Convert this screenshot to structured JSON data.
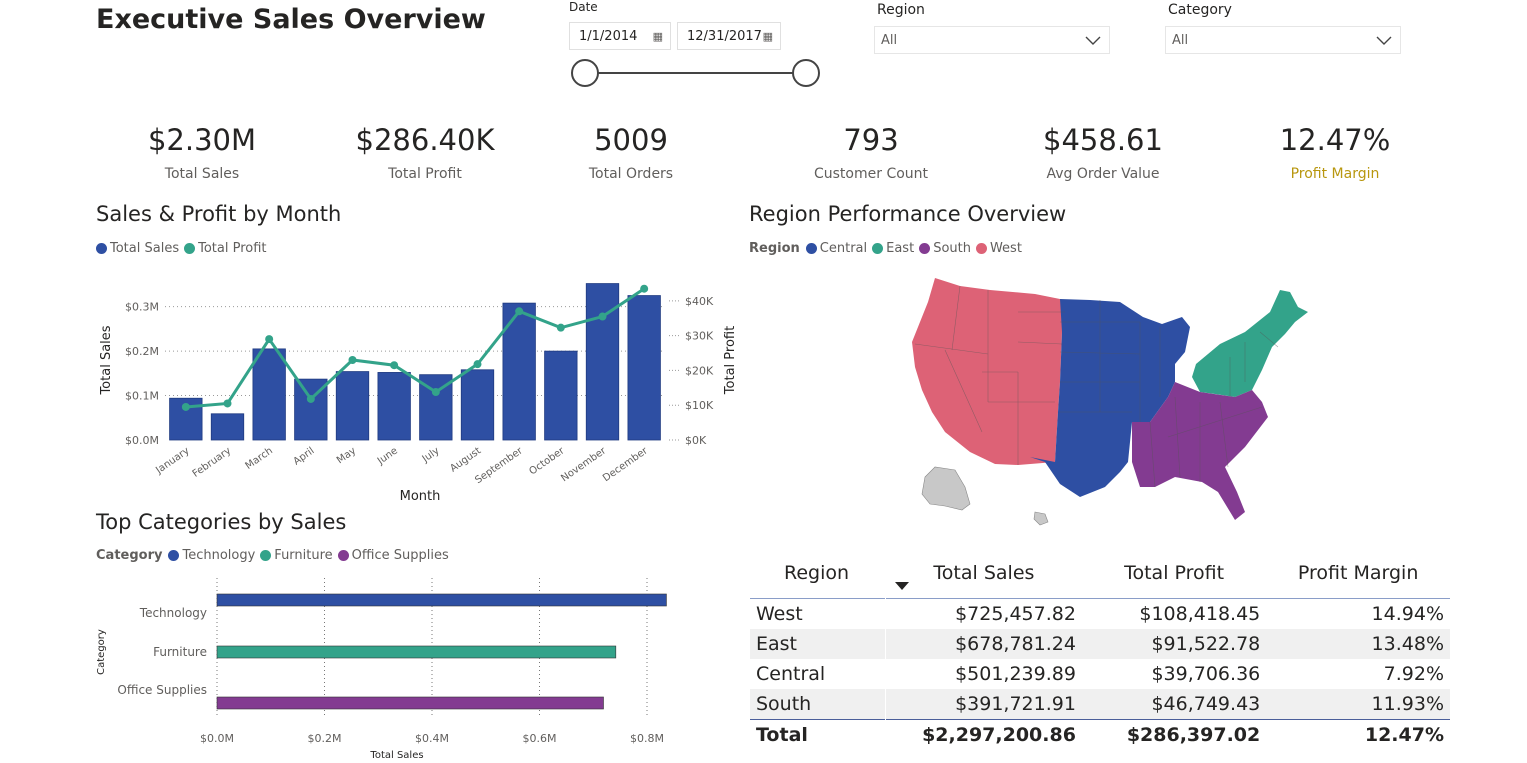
{
  "title": "Executive Sales Overview",
  "filters": {
    "date_label": "Date",
    "date_start": "1/1/2014",
    "date_end": "12/31/2017",
    "region_label": "Region",
    "region_value": "All",
    "category_label": "Category",
    "category_value": "All"
  },
  "kpis": [
    {
      "value": "$2.30M",
      "label": "Total Sales"
    },
    {
      "value": "$286.40K",
      "label": "Total Profit"
    },
    {
      "value": "5009",
      "label": "Total Orders"
    },
    {
      "value": "793",
      "label": "Customer Count"
    },
    {
      "value": "$458.61",
      "label": "Avg Order Value"
    },
    {
      "value": "12.47%",
      "label": "Profit Margin"
    }
  ],
  "colors": {
    "blue": "#2e4fa3",
    "teal": "#33a38a",
    "purple": "#833b91",
    "pink": "#dd6276",
    "gray": "#c8c8c8",
    "profit_margin_label": "#b8970f"
  },
  "map_section": {
    "title": "Region Performance Overview",
    "legend_title": "Region",
    "legend": [
      "Central",
      "East",
      "South",
      "West"
    ]
  },
  "chart_data": [
    {
      "type": "bar",
      "title": "Sales & Profit by Month",
      "xlabel": "Month",
      "ylabel": "Total Sales",
      "y2label": "Total Profit",
      "categories": [
        "January",
        "February",
        "March",
        "April",
        "May",
        "June",
        "July",
        "August",
        "September",
        "October",
        "November",
        "December"
      ],
      "series": [
        {
          "name": "Total Sales",
          "type": "bar",
          "axis": "left",
          "values": [
            94000,
            59000,
            205000,
            137000,
            154000,
            152000,
            147000,
            158000,
            308000,
            200000,
            352000,
            325000
          ]
        },
        {
          "name": "Total Profit",
          "type": "line",
          "axis": "right",
          "values": [
            9500,
            10500,
            29000,
            11800,
            23000,
            21500,
            13800,
            21800,
            37000,
            32300,
            35500,
            43500
          ]
        }
      ],
      "yticks": [
        "$0.0M",
        "$0.1M",
        "$0.2M",
        "$0.3M"
      ],
      "ylim": [
        0,
        0.36
      ],
      "y2ticks": [
        "$0K",
        "$10K",
        "$20K",
        "$30K",
        "$40K"
      ],
      "y2lim": [
        0,
        46000
      ]
    },
    {
      "type": "bar",
      "orientation": "horizontal",
      "title": "Top Categories by Sales",
      "legend_title": "Category",
      "xlabel": "Total Sales",
      "ylabel": "Category",
      "categories": [
        "Technology",
        "Furniture",
        "Office Supplies"
      ],
      "values": [
        836154,
        741999,
        719047
      ],
      "xticks": [
        "$0.0M",
        "$0.2M",
        "$0.4M",
        "$0.6M",
        "$0.8M"
      ],
      "xlim": [
        0,
        0.8
      ]
    },
    {
      "type": "table",
      "columns": [
        "Region",
        "Total Sales",
        "Total Profit",
        "Profit Margin"
      ],
      "rows": [
        [
          "West",
          "$725,457.82",
          "$108,418.45",
          "14.94%"
        ],
        [
          "East",
          "$678,781.24",
          "$91,522.78",
          "13.48%"
        ],
        [
          "Central",
          "$501,239.89",
          "$39,706.36",
          "7.92%"
        ],
        [
          "South",
          "$391,721.91",
          "$46,749.43",
          "11.93%"
        ]
      ],
      "total": [
        "Total",
        "$2,297,200.86",
        "$286,397.02",
        "12.47%"
      ]
    }
  ]
}
